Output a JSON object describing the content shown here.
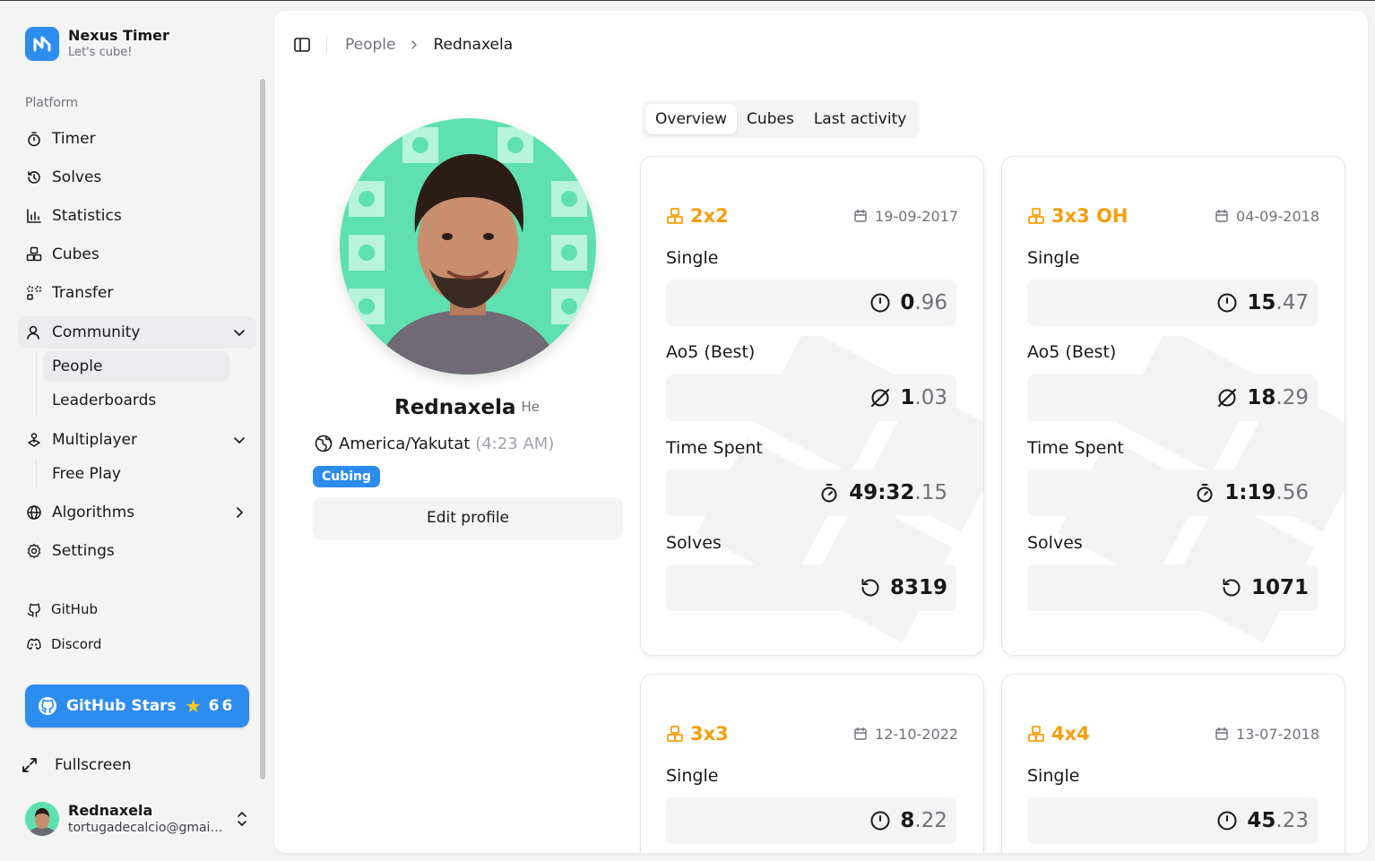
{
  "brand": {
    "name": "Nexus Timer",
    "tagline": "Let's cube!"
  },
  "sidebar": {
    "section_label": "Platform",
    "items": [
      {
        "label": "Timer",
        "icon": "stopwatch-icon"
      },
      {
        "label": "Solves",
        "icon": "history-icon"
      },
      {
        "label": "Statistics",
        "icon": "bar-chart-icon"
      },
      {
        "label": "Cubes",
        "icon": "boxes-icon"
      },
      {
        "label": "Transfer",
        "icon": "transfer-icon"
      },
      {
        "label": "Community",
        "icon": "user-icon"
      },
      {
        "label": "Multiplayer",
        "icon": "joystick-icon"
      },
      {
        "label": "Algorithms",
        "icon": "atom-icon"
      },
      {
        "label": "Settings",
        "icon": "gear-icon"
      }
    ],
    "community_sub": [
      "People",
      "Leaderboards"
    ],
    "multiplayer_sub": [
      "Free Play"
    ],
    "links": [
      {
        "label": "GitHub",
        "icon": "github-icon"
      },
      {
        "label": "Discord",
        "icon": "discord-icon"
      }
    ],
    "stars": {
      "label": "GitHub Stars",
      "count": "66"
    },
    "fullscreen_label": "Fullscreen",
    "user": {
      "name": "Rednaxela",
      "email": "tortugadecalcio@gmail..."
    }
  },
  "breadcrumb": {
    "parent": "People",
    "current": "Rednaxela"
  },
  "profile": {
    "name": "Rednaxela",
    "pronoun": "He",
    "timezone": "America/Yakutat",
    "local_time": "(4:23 AM)",
    "badge": "Cubing",
    "edit_label": "Edit profile"
  },
  "tabs": [
    "Overview",
    "Cubes",
    "Last activity"
  ],
  "labels": {
    "single": "Single",
    "ao5": "Ao5 (Best)",
    "time_spent": "Time Spent",
    "solves": "Solves"
  },
  "cards": [
    {
      "cube": "2x2",
      "date": "19-09-2017",
      "single_int": "0",
      "single_dec": ".96",
      "ao5_int": "1",
      "ao5_dec": ".03",
      "time_int": "49:32",
      "time_dec": ".15",
      "solves": "8319"
    },
    {
      "cube": "3x3 OH",
      "date": "04-09-2018",
      "single_int": "15",
      "single_dec": ".47",
      "ao5_int": "18",
      "ao5_dec": ".29",
      "time_int": "1:19",
      "time_dec": ".56",
      "solves": "1071"
    },
    {
      "cube": "3x3",
      "date": "12-10-2022",
      "single_int": "8",
      "single_dec": ".22"
    },
    {
      "cube": "4x4",
      "date": "13-07-2018",
      "single_int": "45",
      "single_dec": ".23"
    }
  ],
  "colors": {
    "accent": "#2d8cf0",
    "cube_title": "#f59e0b",
    "avatar_bg": "#5ee0b0"
  }
}
